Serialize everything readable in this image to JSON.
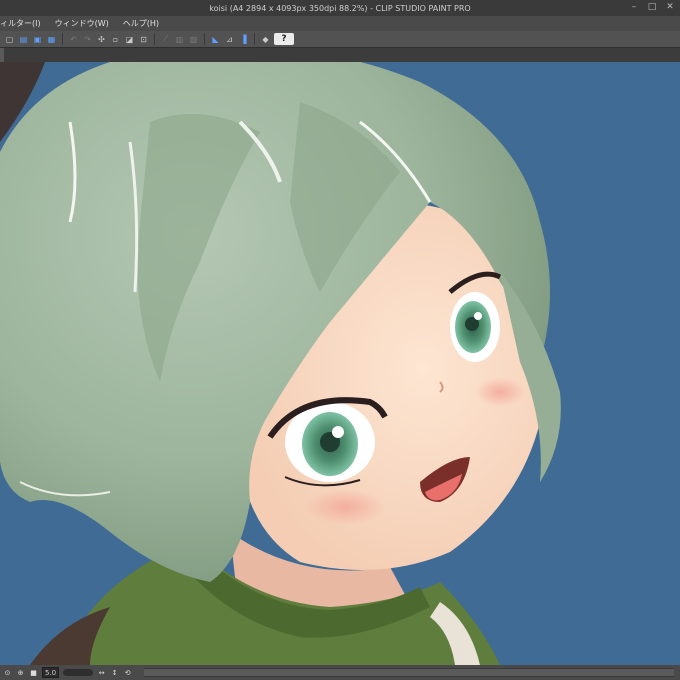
{
  "window": {
    "title": "koisi (A4 2894 x 4093px 350dpi 88.2%)  - CLIP STUDIO PAINT PRO",
    "controls": [
      "minimize-icon",
      "maximize-icon",
      "close-icon"
    ]
  },
  "menu": {
    "items": [
      "ィルター(I)",
      "ウィンドウ(W)",
      "ヘルプ(H)"
    ]
  },
  "toolbar": {
    "help_label": "?"
  },
  "statusbar": {
    "zoom_value": "5.0"
  },
  "colors": {
    "canvas_background": "#3f6b95",
    "ui_dark": "#3a3a3a",
    "ui_mid": "#525252",
    "accent_blue": "#5fa0ff"
  }
}
